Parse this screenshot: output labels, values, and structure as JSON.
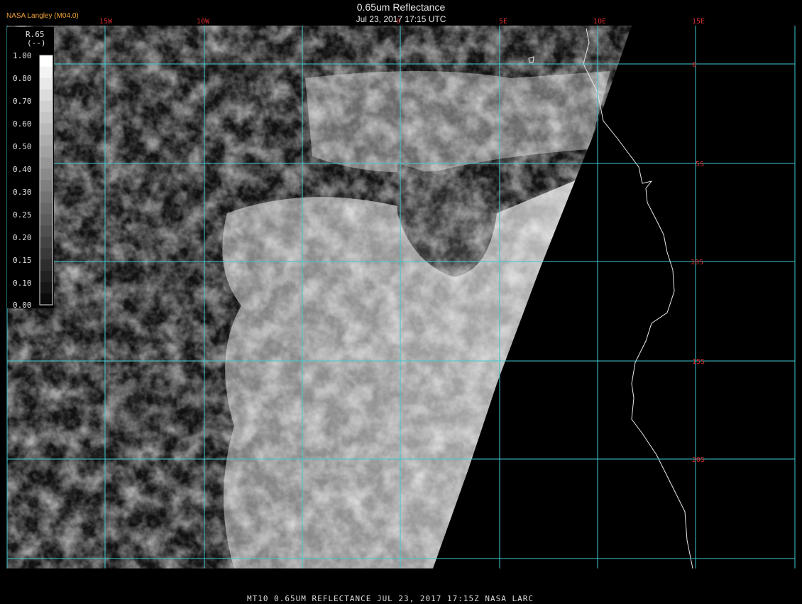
{
  "header": {
    "agency": "NASA Langley (M04.0)",
    "title": "0.65um Reflectance",
    "datetime": "Jul 23, 2017 17:15 UTC"
  },
  "footer": {
    "caption": "MT10  0.65UM REFLECTANCE   JUL 23, 2017 17:15Z   NASA LARC"
  },
  "colors": {
    "grid": "#3ec9d2",
    "label": "#d22c2c",
    "coast": "#e8e8e8",
    "agency": "#f2a23a"
  },
  "grid": {
    "longitudes": [
      "15W",
      "10W",
      "0",
      "5E",
      "10E",
      "15E"
    ],
    "latitudes": [
      "0",
      "5S",
      "10S",
      "15S",
      "20S"
    ]
  },
  "colorbar": {
    "title": "R.65",
    "unit": "(--)",
    "ticks": [
      "1.00",
      "0.80",
      "0.70",
      "0.60",
      "0.50",
      "0.40",
      "0.30",
      "0.25",
      "0.20",
      "0.15",
      "0.10",
      "0.00"
    ]
  }
}
